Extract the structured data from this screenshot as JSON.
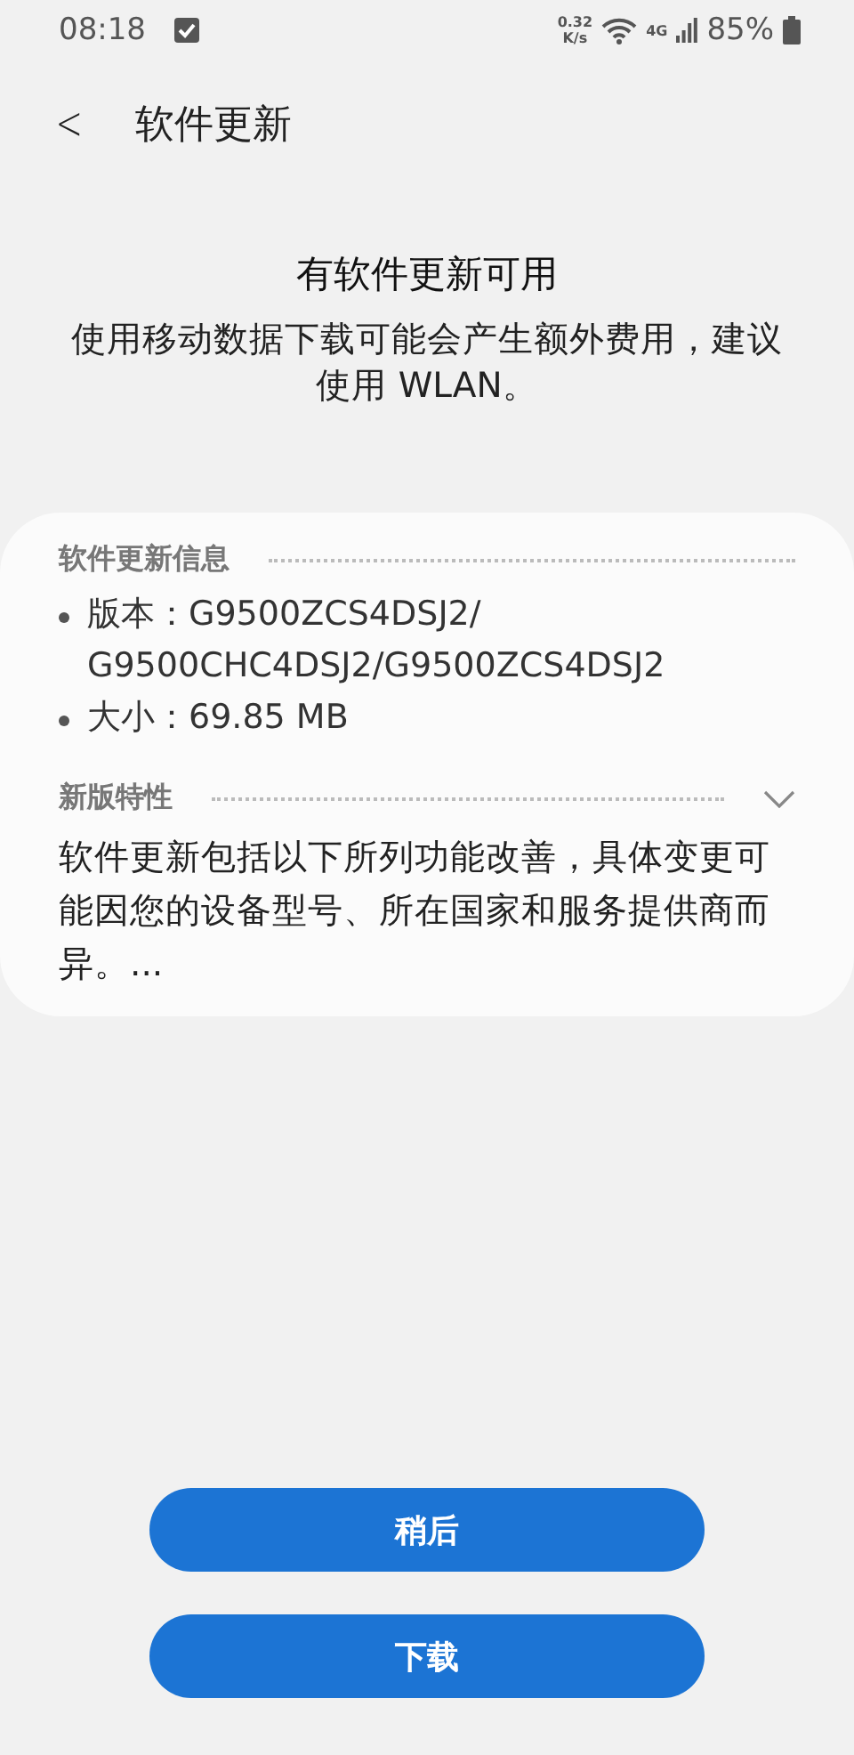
{
  "status_bar": {
    "time": "08:18",
    "speed_value": "0.32",
    "speed_unit": "K/s",
    "network": "4G",
    "battery": "85%"
  },
  "header": {
    "back": "<",
    "title": "软件更新"
  },
  "notice": {
    "title": "有软件更新可用",
    "message": "使用移动数据下载可能会产生额外费用，建议使用 WLAN。"
  },
  "info_card": {
    "section_title": "软件更新信息",
    "items": [
      {
        "lines": [
          "版本：G9500ZCS4DSJ2/",
          "G9500CHC4DSJ2/G9500ZCS4DSJ2"
        ]
      },
      {
        "lines": [
          "大小：69.85 MB"
        ]
      }
    ],
    "features": {
      "title": "新版特性",
      "expanded": false,
      "text": "软件更新包括以下所列功能改善，具体变更可能因您的设备型号、所在国家和服务提供商而异。..."
    }
  },
  "buttons": [
    {
      "label": "稍后"
    },
    {
      "label": "下载"
    }
  ]
}
